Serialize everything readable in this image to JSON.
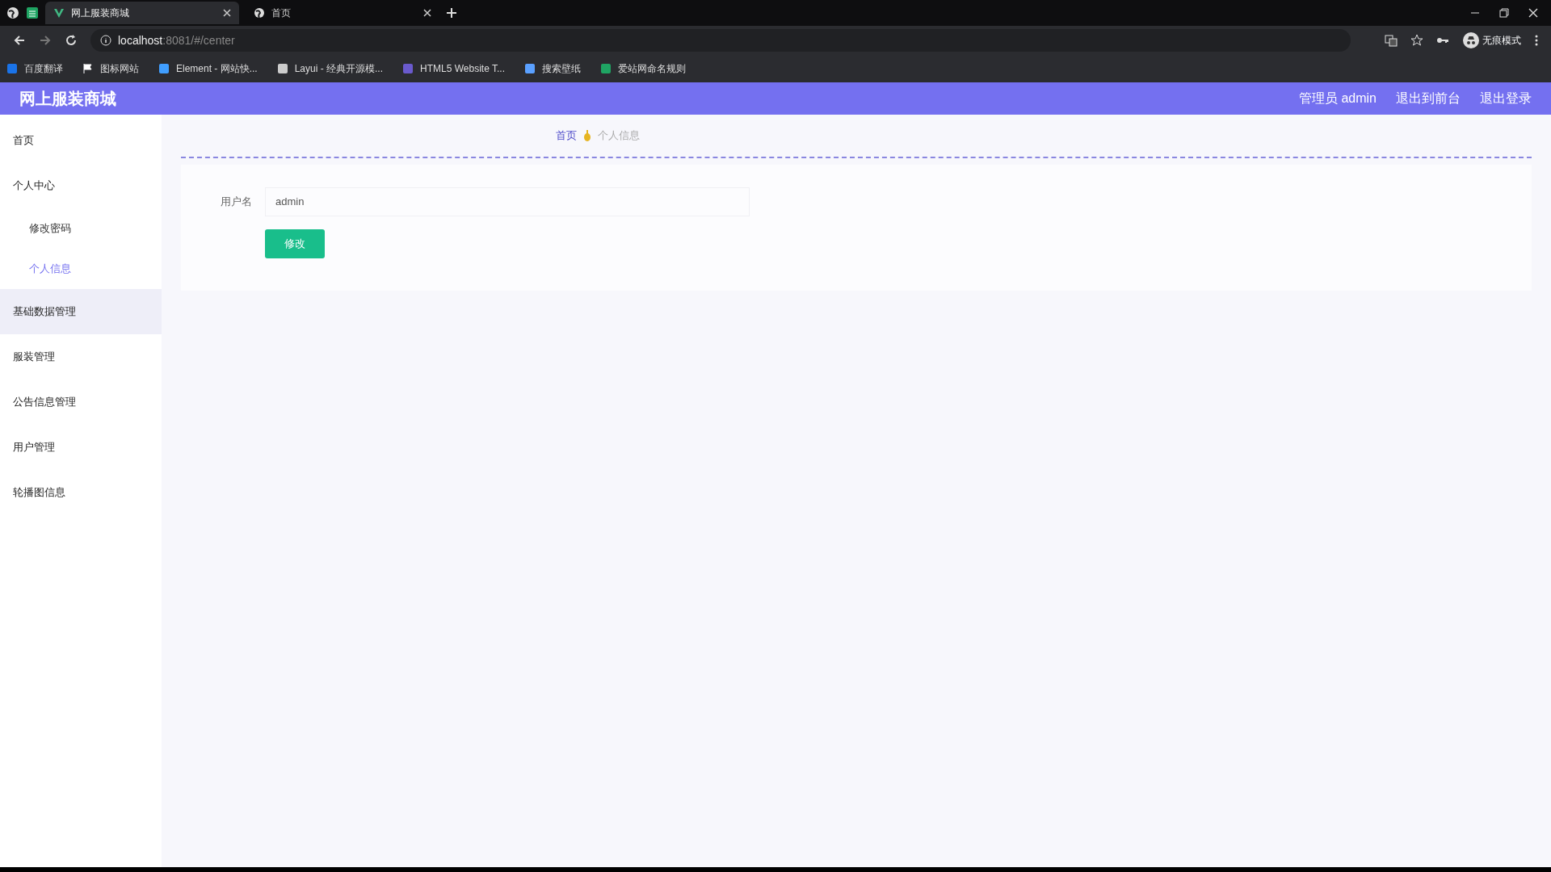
{
  "browser": {
    "tabs": [
      {
        "title": "网上服装商城",
        "selected": true
      },
      {
        "title": "首页",
        "selected": false
      }
    ],
    "url": {
      "host": "localhost",
      "rest": ":8081/#/center"
    },
    "profile": "无痕模式",
    "bookmarks": [
      "百度翻译",
      "图标网站",
      "Element - 网站快...",
      "Layui - 经典开源模...",
      "HTML5 Website T...",
      "搜索壁纸",
      "爱站网命名规则"
    ]
  },
  "header": {
    "title": "网上服装商城",
    "user": "管理员 admin",
    "links": [
      "退出到前台",
      "退出登录"
    ]
  },
  "sidebar": {
    "items": [
      {
        "label": "首页",
        "hovered": false
      },
      {
        "label": "个人中心",
        "hovered": false,
        "children": [
          {
            "label": "修改密码",
            "selected": false
          },
          {
            "label": "个人信息",
            "selected": true
          }
        ]
      },
      {
        "label": "基础数据管理",
        "hovered": true
      },
      {
        "label": "服装管理",
        "hovered": false
      },
      {
        "label": "公告信息管理",
        "hovered": false
      },
      {
        "label": "用户管理",
        "hovered": false
      },
      {
        "label": "轮播图信息",
        "hovered": false
      }
    ]
  },
  "breadcrumb": [
    "首页",
    "个人信息"
  ],
  "form": {
    "fields": [
      {
        "label": "用户名",
        "value": "admin"
      }
    ],
    "button": "修改"
  }
}
